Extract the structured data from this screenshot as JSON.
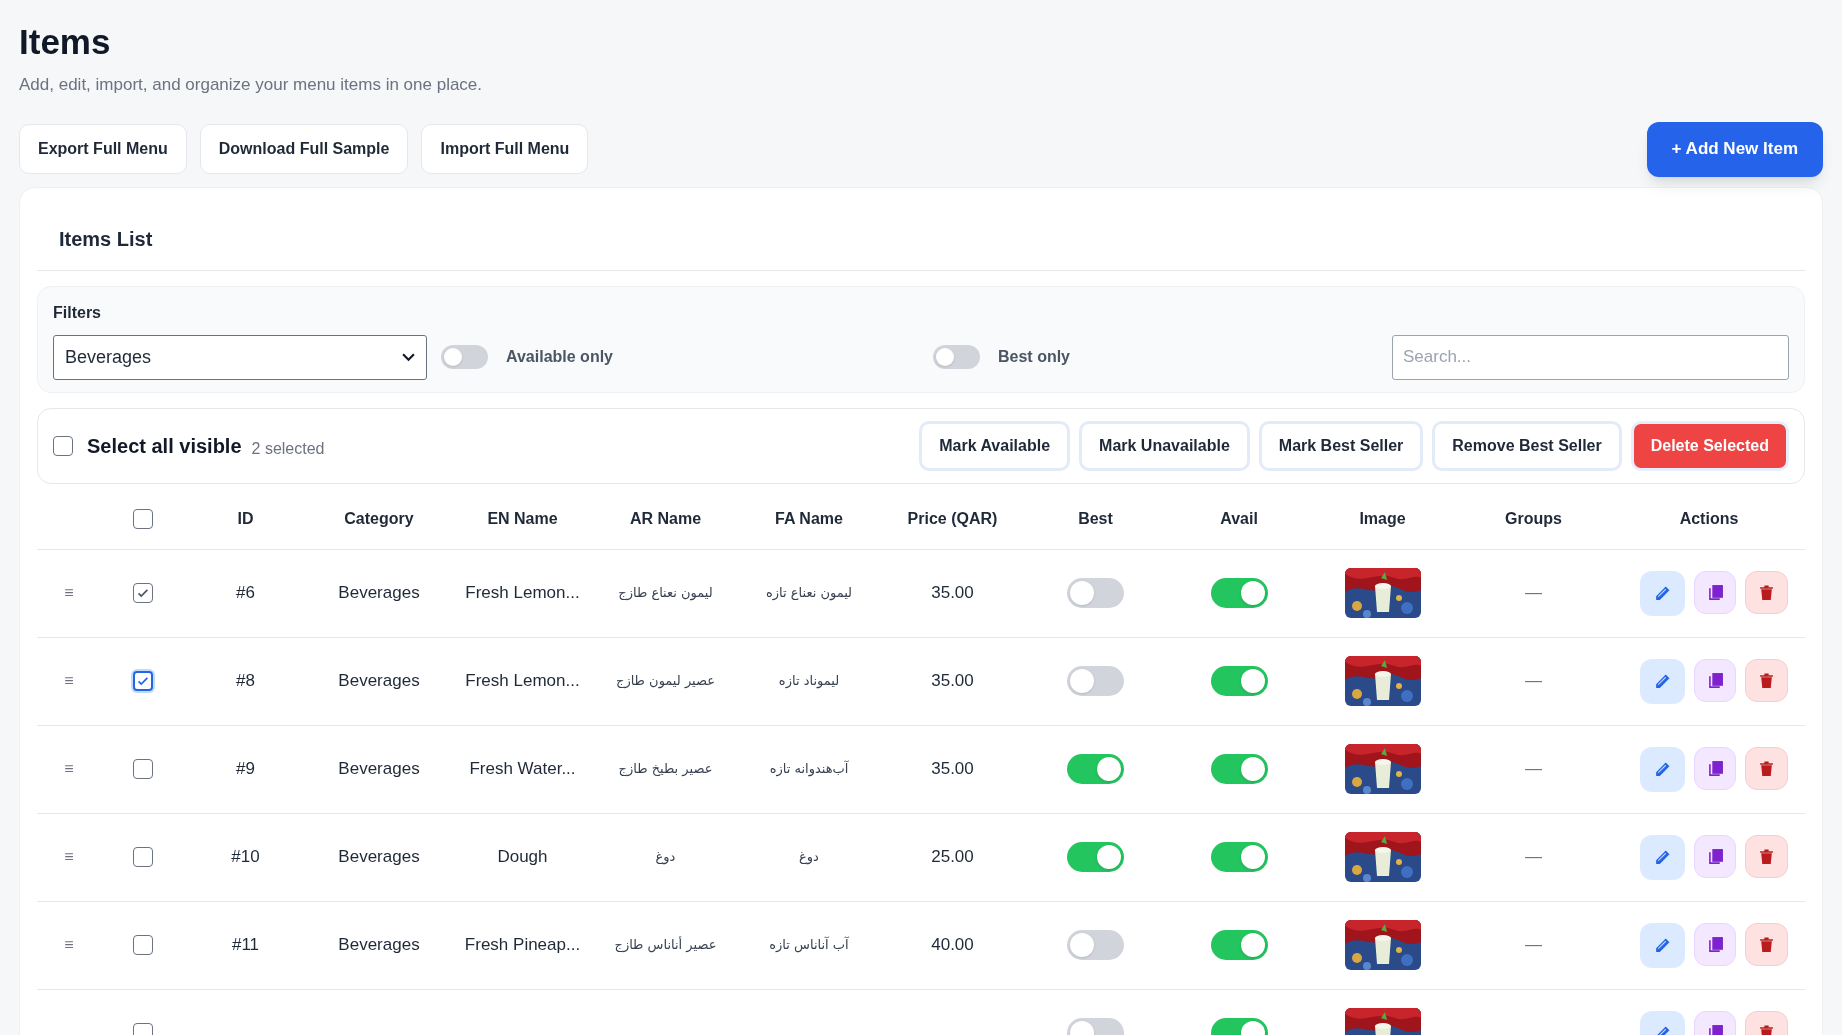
{
  "page": {
    "title": "Items",
    "subtitle": "Add, edit, import, and organize your menu items in one place."
  },
  "toolbar_buttons": [
    "Export Full Menu",
    "Download Full Sample",
    "Import Full Menu"
  ],
  "add_button": "+ Add New Item",
  "card_title": "Items List",
  "filters": {
    "label": "Filters",
    "category": "Beverages",
    "available_only": {
      "label": "Available only",
      "on": false
    },
    "best_only": {
      "label": "Best only",
      "on": false
    },
    "search": {
      "placeholder": "Search..."
    }
  },
  "bulk": {
    "select_all": {
      "label": "Select all visible",
      "checked": false
    },
    "count": "2 selected",
    "actions": [
      {
        "label": "Mark Available",
        "kind": "plain"
      },
      {
        "label": "Mark Unavailable",
        "kind": "plain"
      },
      {
        "label": "Mark Best Seller",
        "kind": "plain"
      },
      {
        "label": "Remove Best Seller",
        "kind": "plain"
      },
      {
        "label": "Delete Selected",
        "kind": "danger"
      }
    ]
  },
  "table": {
    "header_checked": false,
    "columns": [
      "ID",
      "Category",
      "EN Name",
      "AR Name",
      "FA Name",
      "Price (QAR)",
      "Best",
      "Avail",
      "Image",
      "Groups",
      "Actions"
    ],
    "rows": [
      {
        "handle": "≡",
        "checked": true,
        "focused": false,
        "id": "#6",
        "category": "Beverages",
        "en": "Fresh Lemon...",
        "ar": "ليمون نعناع طازج",
        "fa": "ليمون نعناع تازه",
        "price": "35.00",
        "best": false,
        "avail": true,
        "groups": "—"
      },
      {
        "handle": "≡",
        "checked": true,
        "focused": true,
        "id": "#8",
        "category": "Beverages",
        "en": "Fresh Lemon...",
        "ar": "عصير ليمون طازج",
        "fa": "ليموناد تازه",
        "price": "35.00",
        "best": false,
        "avail": true,
        "groups": "—"
      },
      {
        "handle": "≡",
        "checked": false,
        "focused": false,
        "id": "#9",
        "category": "Beverages",
        "en": "Fresh Water...",
        "ar": "عصير بطيخ طازج",
        "fa": "آب‌هندوانه تازه",
        "price": "35.00",
        "best": true,
        "avail": true,
        "groups": "—"
      },
      {
        "handle": "≡",
        "checked": false,
        "focused": false,
        "id": "#10",
        "category": "Beverages",
        "en": "Dough",
        "ar": "دوغ",
        "fa": "دوغ",
        "price": "25.00",
        "best": true,
        "avail": true,
        "groups": "—"
      },
      {
        "handle": "≡",
        "checked": false,
        "focused": false,
        "id": "#11",
        "category": "Beverages",
        "en": "Fresh Pineap...",
        "ar": "عصير أناناس طازج",
        "fa": "آب آناناس تازه",
        "price": "40.00",
        "best": false,
        "avail": true,
        "groups": "—"
      },
      {
        "checked": false,
        "focused": false,
        "best": false,
        "avail": true
      }
    ]
  }
}
